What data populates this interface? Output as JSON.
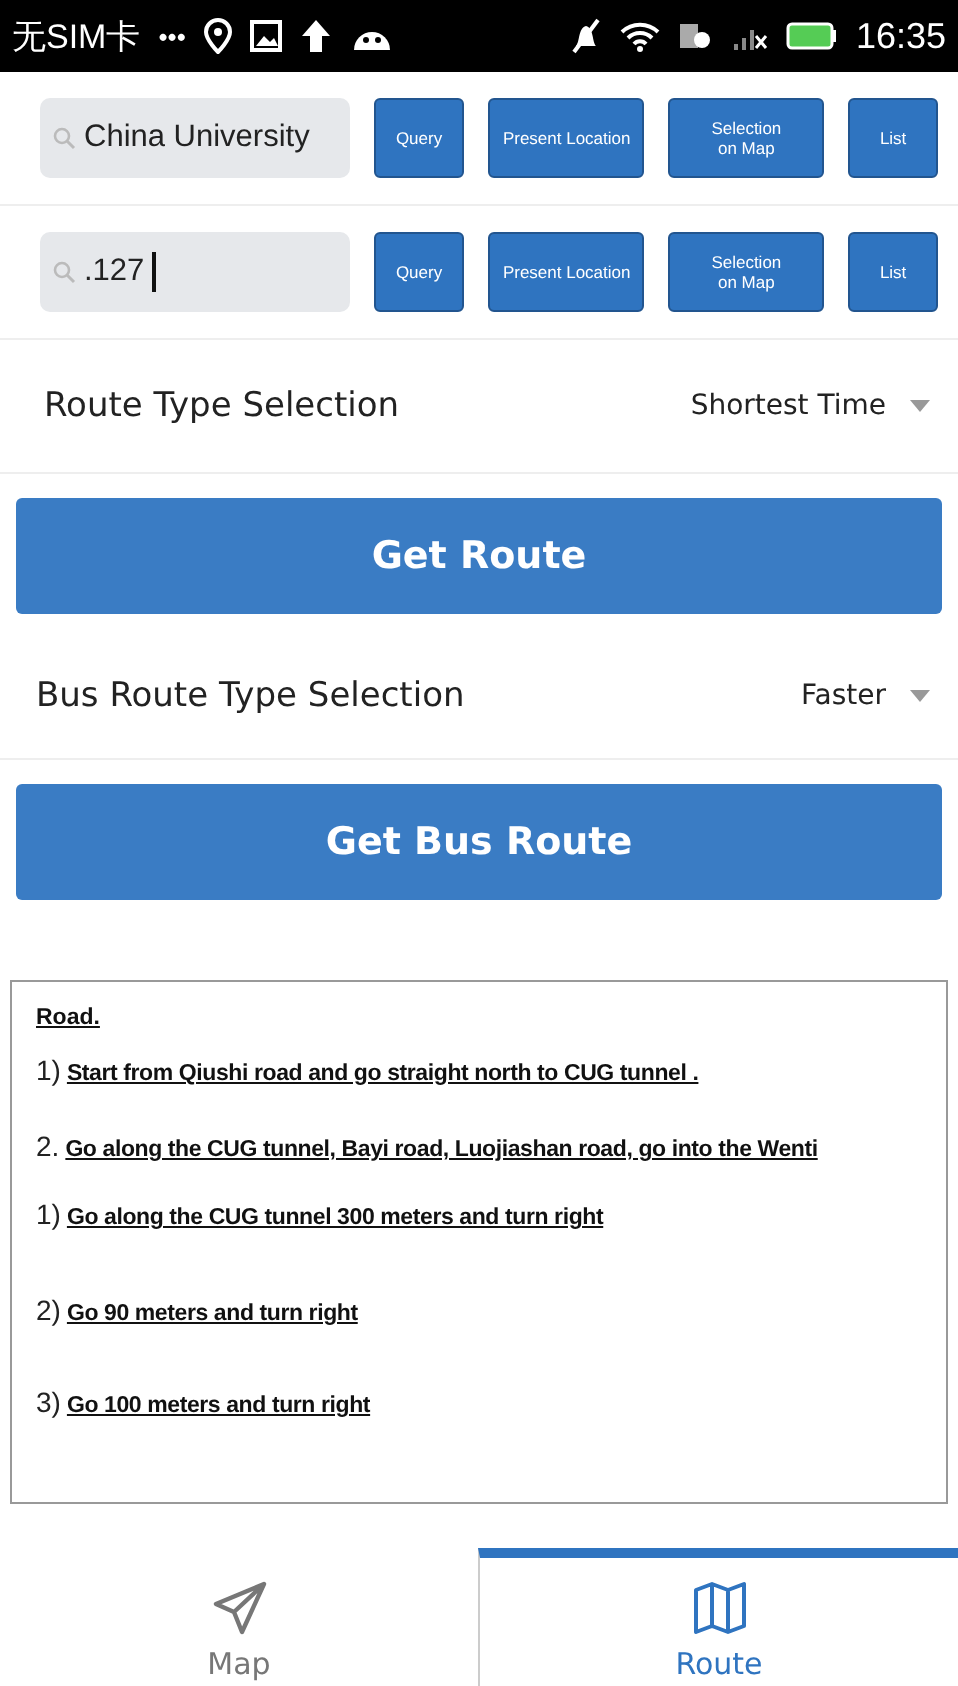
{
  "status_bar": {
    "carrier": "无SIM卡",
    "dots": "•••",
    "time": "16:35"
  },
  "search_rows": [
    {
      "value": "China University",
      "buttons": [
        "Query",
        "Present Location",
        "Selection on Map",
        "List"
      ],
      "caret": false
    },
    {
      "value": ".127",
      "buttons": [
        "Query",
        "Present Location",
        "Selection on Map",
        "List"
      ],
      "caret": true
    }
  ],
  "route_type": {
    "label": "Route Type Selection",
    "value": "Shortest Time"
  },
  "get_route_button": "Get Route",
  "bus_route_type": {
    "label": "Bus Route Type Selection",
    "value": "Faster"
  },
  "get_bus_route_button": "Get Bus Route",
  "directions": {
    "heading": "Road.",
    "steps": [
      {
        "number": "1)",
        "text": "Start from Qiushi road and go straight north to CUG tunnel ."
      },
      {
        "number": "2.",
        "text": "Go along the CUG tunnel, Bayi road, Luojiashan road, go into the Wenti"
      },
      {
        "number": "1)",
        "text": "Go along the CUG tunnel 300 meters and turn right"
      },
      {
        "number": "2)",
        "text": "Go 90 meters and turn right"
      },
      {
        "number": "3)",
        "text": "Go 100 meters and turn right"
      }
    ]
  },
  "tabs": [
    {
      "label": "Map",
      "kind": "plane",
      "selected": false
    },
    {
      "label": "Route",
      "kind": "map",
      "selected": true
    }
  ]
}
